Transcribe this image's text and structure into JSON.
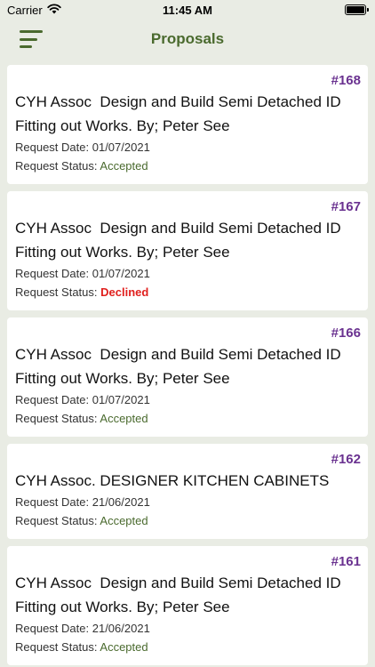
{
  "status_bar": {
    "carrier": "Carrier",
    "time": "11:45 AM",
    "icons": [
      "wifi-icon",
      "battery-icon"
    ]
  },
  "nav": {
    "title": "Proposals",
    "menu_icon": "menu-icon"
  },
  "labels": {
    "request_date": "Request Date:",
    "request_status": "Request Status:"
  },
  "colors": {
    "brand_green": "#4a6a2e",
    "number_purple": "#6a3290",
    "declined_red": "#e0201e",
    "background": "#e9ece4"
  },
  "proposals": [
    {
      "number": "#168",
      "title": "CYH Assoc  Design and Build Semi Detached ID Fitting out Works. By; Peter See",
      "date": "01/07/2021",
      "status": "Accepted"
    },
    {
      "number": "#167",
      "title": "CYH Assoc  Design and Build Semi Detached ID Fitting out Works. By; Peter See",
      "date": "01/07/2021",
      "status": "Declined"
    },
    {
      "number": "#166",
      "title": "CYH Assoc  Design and Build Semi Detached ID Fitting out Works. By; Peter See",
      "date": "01/07/2021",
      "status": "Accepted"
    },
    {
      "number": "#162",
      "title": "CYH Assoc. DESIGNER KITCHEN CABINETS",
      "date": "21/06/2021",
      "status": "Accepted"
    },
    {
      "number": "#161",
      "title": "CYH Assoc  Design and Build Semi Detached ID Fitting out Works. By; Peter See",
      "date": "21/06/2021",
      "status": "Accepted"
    }
  ]
}
